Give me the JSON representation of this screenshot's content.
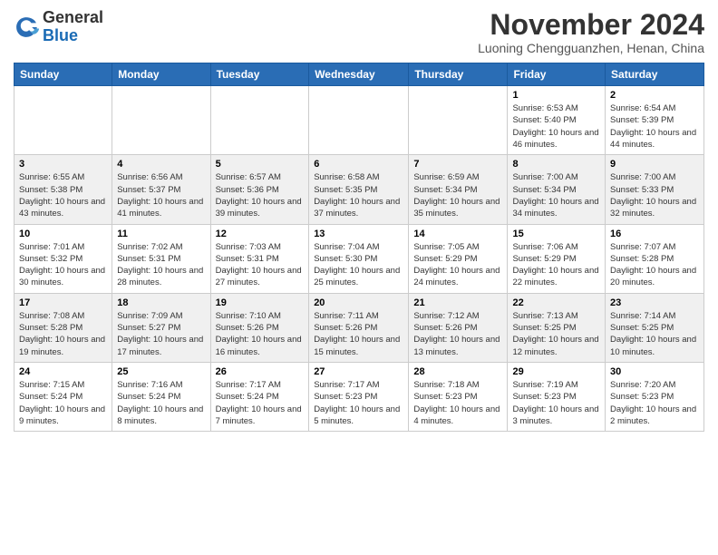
{
  "header": {
    "logo_general": "General",
    "logo_blue": "Blue",
    "month_title": "November 2024",
    "location": "Luoning Chengguanzhen, Henan, China"
  },
  "calendar": {
    "days_of_week": [
      "Sunday",
      "Monday",
      "Tuesday",
      "Wednesday",
      "Thursday",
      "Friday",
      "Saturday"
    ],
    "weeks": [
      [
        {
          "day": "",
          "info": ""
        },
        {
          "day": "",
          "info": ""
        },
        {
          "day": "",
          "info": ""
        },
        {
          "day": "",
          "info": ""
        },
        {
          "day": "",
          "info": ""
        },
        {
          "day": "1",
          "info": "Sunrise: 6:53 AM\nSunset: 5:40 PM\nDaylight: 10 hours and 46 minutes."
        },
        {
          "day": "2",
          "info": "Sunrise: 6:54 AM\nSunset: 5:39 PM\nDaylight: 10 hours and 44 minutes."
        }
      ],
      [
        {
          "day": "3",
          "info": "Sunrise: 6:55 AM\nSunset: 5:38 PM\nDaylight: 10 hours and 43 minutes."
        },
        {
          "day": "4",
          "info": "Sunrise: 6:56 AM\nSunset: 5:37 PM\nDaylight: 10 hours and 41 minutes."
        },
        {
          "day": "5",
          "info": "Sunrise: 6:57 AM\nSunset: 5:36 PM\nDaylight: 10 hours and 39 minutes."
        },
        {
          "day": "6",
          "info": "Sunrise: 6:58 AM\nSunset: 5:35 PM\nDaylight: 10 hours and 37 minutes."
        },
        {
          "day": "7",
          "info": "Sunrise: 6:59 AM\nSunset: 5:34 PM\nDaylight: 10 hours and 35 minutes."
        },
        {
          "day": "8",
          "info": "Sunrise: 7:00 AM\nSunset: 5:34 PM\nDaylight: 10 hours and 34 minutes."
        },
        {
          "day": "9",
          "info": "Sunrise: 7:00 AM\nSunset: 5:33 PM\nDaylight: 10 hours and 32 minutes."
        }
      ],
      [
        {
          "day": "10",
          "info": "Sunrise: 7:01 AM\nSunset: 5:32 PM\nDaylight: 10 hours and 30 minutes."
        },
        {
          "day": "11",
          "info": "Sunrise: 7:02 AM\nSunset: 5:31 PM\nDaylight: 10 hours and 28 minutes."
        },
        {
          "day": "12",
          "info": "Sunrise: 7:03 AM\nSunset: 5:31 PM\nDaylight: 10 hours and 27 minutes."
        },
        {
          "day": "13",
          "info": "Sunrise: 7:04 AM\nSunset: 5:30 PM\nDaylight: 10 hours and 25 minutes."
        },
        {
          "day": "14",
          "info": "Sunrise: 7:05 AM\nSunset: 5:29 PM\nDaylight: 10 hours and 24 minutes."
        },
        {
          "day": "15",
          "info": "Sunrise: 7:06 AM\nSunset: 5:29 PM\nDaylight: 10 hours and 22 minutes."
        },
        {
          "day": "16",
          "info": "Sunrise: 7:07 AM\nSunset: 5:28 PM\nDaylight: 10 hours and 20 minutes."
        }
      ],
      [
        {
          "day": "17",
          "info": "Sunrise: 7:08 AM\nSunset: 5:28 PM\nDaylight: 10 hours and 19 minutes."
        },
        {
          "day": "18",
          "info": "Sunrise: 7:09 AM\nSunset: 5:27 PM\nDaylight: 10 hours and 17 minutes."
        },
        {
          "day": "19",
          "info": "Sunrise: 7:10 AM\nSunset: 5:26 PM\nDaylight: 10 hours and 16 minutes."
        },
        {
          "day": "20",
          "info": "Sunrise: 7:11 AM\nSunset: 5:26 PM\nDaylight: 10 hours and 15 minutes."
        },
        {
          "day": "21",
          "info": "Sunrise: 7:12 AM\nSunset: 5:26 PM\nDaylight: 10 hours and 13 minutes."
        },
        {
          "day": "22",
          "info": "Sunrise: 7:13 AM\nSunset: 5:25 PM\nDaylight: 10 hours and 12 minutes."
        },
        {
          "day": "23",
          "info": "Sunrise: 7:14 AM\nSunset: 5:25 PM\nDaylight: 10 hours and 10 minutes."
        }
      ],
      [
        {
          "day": "24",
          "info": "Sunrise: 7:15 AM\nSunset: 5:24 PM\nDaylight: 10 hours and 9 minutes."
        },
        {
          "day": "25",
          "info": "Sunrise: 7:16 AM\nSunset: 5:24 PM\nDaylight: 10 hours and 8 minutes."
        },
        {
          "day": "26",
          "info": "Sunrise: 7:17 AM\nSunset: 5:24 PM\nDaylight: 10 hours and 7 minutes."
        },
        {
          "day": "27",
          "info": "Sunrise: 7:17 AM\nSunset: 5:23 PM\nDaylight: 10 hours and 5 minutes."
        },
        {
          "day": "28",
          "info": "Sunrise: 7:18 AM\nSunset: 5:23 PM\nDaylight: 10 hours and 4 minutes."
        },
        {
          "day": "29",
          "info": "Sunrise: 7:19 AM\nSunset: 5:23 PM\nDaylight: 10 hours and 3 minutes."
        },
        {
          "day": "30",
          "info": "Sunrise: 7:20 AM\nSunset: 5:23 PM\nDaylight: 10 hours and 2 minutes."
        }
      ]
    ]
  }
}
